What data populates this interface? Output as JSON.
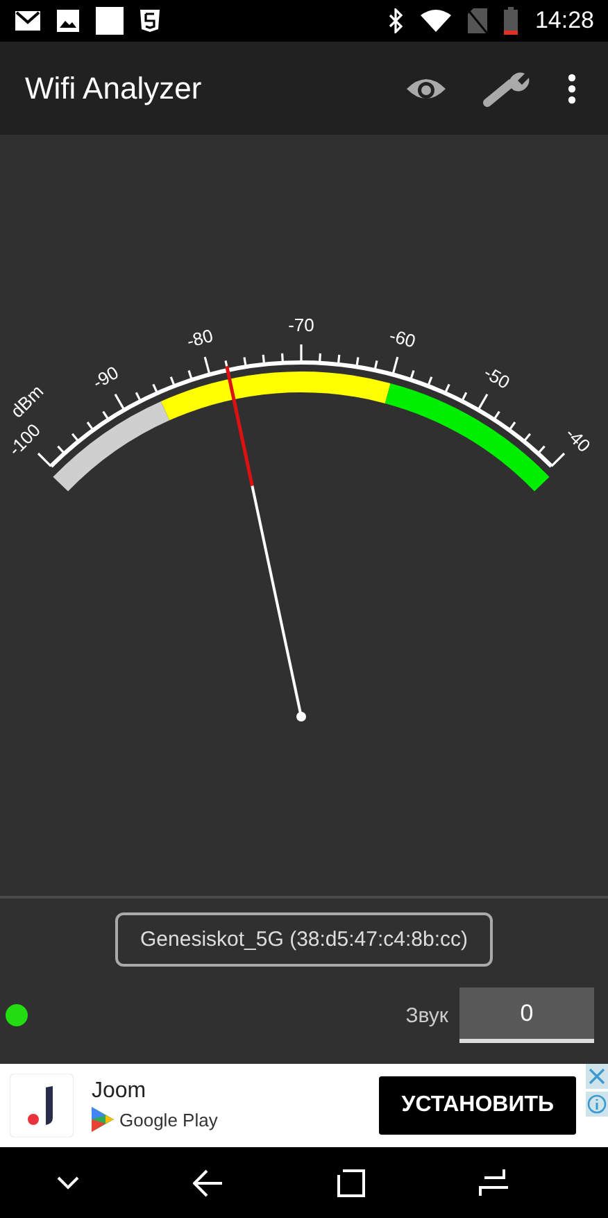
{
  "status_bar": {
    "time": "14:28"
  },
  "app_bar": {
    "title": "Wifi Analyzer"
  },
  "gauge": {
    "unit": "dBm",
    "scale_labels": [
      "-100",
      "-90",
      "-80",
      "-70",
      "-60",
      "-50",
      "-40"
    ]
  },
  "network": {
    "label": "Genesiskot_5G (38:d5:47:c4:8b:cc)"
  },
  "indicator": {
    "on": true
  },
  "sound": {
    "label": "Звук",
    "value": "0"
  },
  "ad": {
    "app_name": "Joom",
    "store": "Google Play",
    "button": "УСТАНОВИТЬ"
  }
}
